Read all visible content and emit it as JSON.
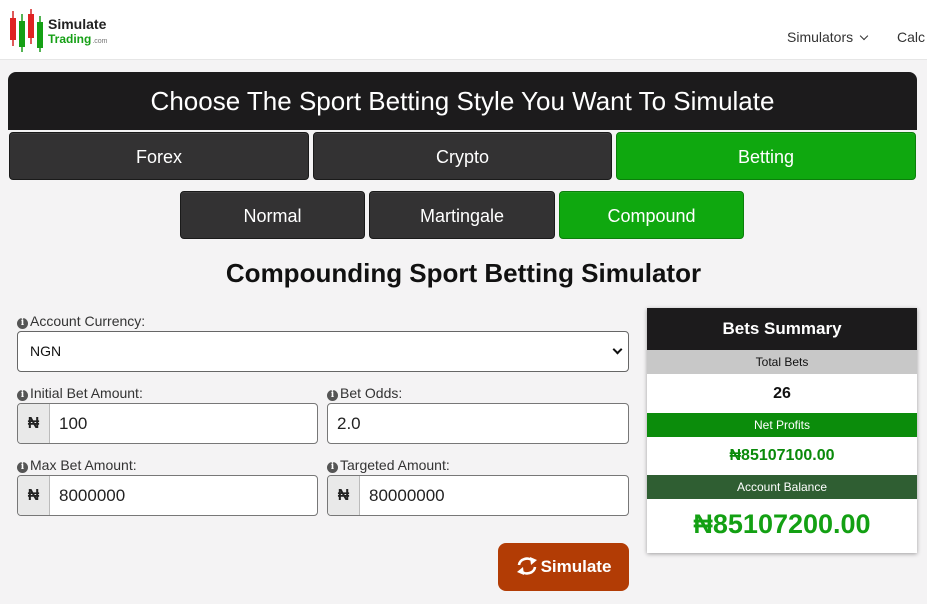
{
  "header": {
    "logo_line1": "Simulate",
    "logo_line2": "Trading",
    "logo_suffix": ".com",
    "nav_simulators": "Simulators",
    "nav_calc": "Calc"
  },
  "banner": {
    "title": "Choose The Sport Betting Style You Want To Simulate"
  },
  "tabs": [
    {
      "label": "Forex",
      "active": false
    },
    {
      "label": "Crypto",
      "active": false
    },
    {
      "label": "Betting",
      "active": true
    }
  ],
  "subtabs": [
    {
      "label": "Normal",
      "active": false
    },
    {
      "label": "Martingale",
      "active": false
    },
    {
      "label": "Compound",
      "active": true
    }
  ],
  "page_title": "Compounding Sport Betting Simulator",
  "form": {
    "currency_label": "Account Currency:",
    "currency_value": "NGN",
    "initial_bet_label": "Initial Bet Amount:",
    "initial_bet_value": "100",
    "bet_odds_label": "Bet Odds:",
    "bet_odds_value": "2.0",
    "max_bet_label": "Max Bet Amount:",
    "max_bet_value": "8000000",
    "target_label": "Targeted Amount:",
    "target_value": "80000000",
    "currency_symbol": "₦",
    "info_glyph": "i",
    "simulate_label": "Simulate"
  },
  "summary": {
    "title": "Bets Summary",
    "total_bets_label": "Total Bets",
    "total_bets_value": "26",
    "net_profits_label": "Net Profits",
    "net_profits_value": "₦85107100.00",
    "balance_label": "Account Balance",
    "balance_value": "₦85107200.00"
  },
  "colors": {
    "accent_green": "#0fa80f",
    "dark": "#1c1b1c",
    "simulate_orange": "#b23c05"
  }
}
